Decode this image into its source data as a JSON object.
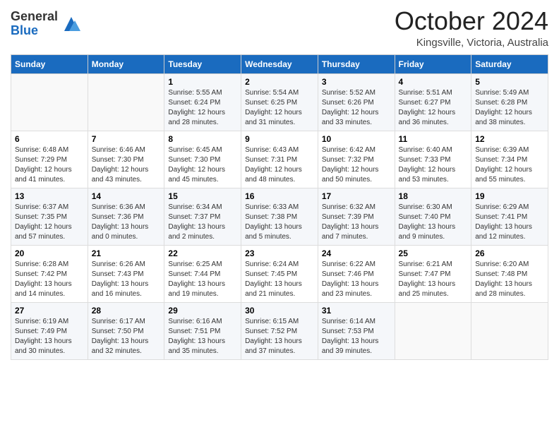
{
  "header": {
    "logo_general": "General",
    "logo_blue": "Blue",
    "month_title": "October 2024",
    "location": "Kingsville, Victoria, Australia"
  },
  "weekdays": [
    "Sunday",
    "Monday",
    "Tuesday",
    "Wednesday",
    "Thursday",
    "Friday",
    "Saturday"
  ],
  "weeks": [
    [
      {
        "day": "",
        "sunrise": "",
        "sunset": "",
        "daylight": ""
      },
      {
        "day": "",
        "sunrise": "",
        "sunset": "",
        "daylight": ""
      },
      {
        "day": "1",
        "sunrise": "Sunrise: 5:55 AM",
        "sunset": "Sunset: 6:24 PM",
        "daylight": "Daylight: 12 hours and 28 minutes."
      },
      {
        "day": "2",
        "sunrise": "Sunrise: 5:54 AM",
        "sunset": "Sunset: 6:25 PM",
        "daylight": "Daylight: 12 hours and 31 minutes."
      },
      {
        "day": "3",
        "sunrise": "Sunrise: 5:52 AM",
        "sunset": "Sunset: 6:26 PM",
        "daylight": "Daylight: 12 hours and 33 minutes."
      },
      {
        "day": "4",
        "sunrise": "Sunrise: 5:51 AM",
        "sunset": "Sunset: 6:27 PM",
        "daylight": "Daylight: 12 hours and 36 minutes."
      },
      {
        "day": "5",
        "sunrise": "Sunrise: 5:49 AM",
        "sunset": "Sunset: 6:28 PM",
        "daylight": "Daylight: 12 hours and 38 minutes."
      }
    ],
    [
      {
        "day": "6",
        "sunrise": "Sunrise: 6:48 AM",
        "sunset": "Sunset: 7:29 PM",
        "daylight": "Daylight: 12 hours and 41 minutes."
      },
      {
        "day": "7",
        "sunrise": "Sunrise: 6:46 AM",
        "sunset": "Sunset: 7:30 PM",
        "daylight": "Daylight: 12 hours and 43 minutes."
      },
      {
        "day": "8",
        "sunrise": "Sunrise: 6:45 AM",
        "sunset": "Sunset: 7:30 PM",
        "daylight": "Daylight: 12 hours and 45 minutes."
      },
      {
        "day": "9",
        "sunrise": "Sunrise: 6:43 AM",
        "sunset": "Sunset: 7:31 PM",
        "daylight": "Daylight: 12 hours and 48 minutes."
      },
      {
        "day": "10",
        "sunrise": "Sunrise: 6:42 AM",
        "sunset": "Sunset: 7:32 PM",
        "daylight": "Daylight: 12 hours and 50 minutes."
      },
      {
        "day": "11",
        "sunrise": "Sunrise: 6:40 AM",
        "sunset": "Sunset: 7:33 PM",
        "daylight": "Daylight: 12 hours and 53 minutes."
      },
      {
        "day": "12",
        "sunrise": "Sunrise: 6:39 AM",
        "sunset": "Sunset: 7:34 PM",
        "daylight": "Daylight: 12 hours and 55 minutes."
      }
    ],
    [
      {
        "day": "13",
        "sunrise": "Sunrise: 6:37 AM",
        "sunset": "Sunset: 7:35 PM",
        "daylight": "Daylight: 12 hours and 57 minutes."
      },
      {
        "day": "14",
        "sunrise": "Sunrise: 6:36 AM",
        "sunset": "Sunset: 7:36 PM",
        "daylight": "Daylight: 13 hours and 0 minutes."
      },
      {
        "day": "15",
        "sunrise": "Sunrise: 6:34 AM",
        "sunset": "Sunset: 7:37 PM",
        "daylight": "Daylight: 13 hours and 2 minutes."
      },
      {
        "day": "16",
        "sunrise": "Sunrise: 6:33 AM",
        "sunset": "Sunset: 7:38 PM",
        "daylight": "Daylight: 13 hours and 5 minutes."
      },
      {
        "day": "17",
        "sunrise": "Sunrise: 6:32 AM",
        "sunset": "Sunset: 7:39 PM",
        "daylight": "Daylight: 13 hours and 7 minutes."
      },
      {
        "day": "18",
        "sunrise": "Sunrise: 6:30 AM",
        "sunset": "Sunset: 7:40 PM",
        "daylight": "Daylight: 13 hours and 9 minutes."
      },
      {
        "day": "19",
        "sunrise": "Sunrise: 6:29 AM",
        "sunset": "Sunset: 7:41 PM",
        "daylight": "Daylight: 13 hours and 12 minutes."
      }
    ],
    [
      {
        "day": "20",
        "sunrise": "Sunrise: 6:28 AM",
        "sunset": "Sunset: 7:42 PM",
        "daylight": "Daylight: 13 hours and 14 minutes."
      },
      {
        "day": "21",
        "sunrise": "Sunrise: 6:26 AM",
        "sunset": "Sunset: 7:43 PM",
        "daylight": "Daylight: 13 hours and 16 minutes."
      },
      {
        "day": "22",
        "sunrise": "Sunrise: 6:25 AM",
        "sunset": "Sunset: 7:44 PM",
        "daylight": "Daylight: 13 hours and 19 minutes."
      },
      {
        "day": "23",
        "sunrise": "Sunrise: 6:24 AM",
        "sunset": "Sunset: 7:45 PM",
        "daylight": "Daylight: 13 hours and 21 minutes."
      },
      {
        "day": "24",
        "sunrise": "Sunrise: 6:22 AM",
        "sunset": "Sunset: 7:46 PM",
        "daylight": "Daylight: 13 hours and 23 minutes."
      },
      {
        "day": "25",
        "sunrise": "Sunrise: 6:21 AM",
        "sunset": "Sunset: 7:47 PM",
        "daylight": "Daylight: 13 hours and 25 minutes."
      },
      {
        "day": "26",
        "sunrise": "Sunrise: 6:20 AM",
        "sunset": "Sunset: 7:48 PM",
        "daylight": "Daylight: 13 hours and 28 minutes."
      }
    ],
    [
      {
        "day": "27",
        "sunrise": "Sunrise: 6:19 AM",
        "sunset": "Sunset: 7:49 PM",
        "daylight": "Daylight: 13 hours and 30 minutes."
      },
      {
        "day": "28",
        "sunrise": "Sunrise: 6:17 AM",
        "sunset": "Sunset: 7:50 PM",
        "daylight": "Daylight: 13 hours and 32 minutes."
      },
      {
        "day": "29",
        "sunrise": "Sunrise: 6:16 AM",
        "sunset": "Sunset: 7:51 PM",
        "daylight": "Daylight: 13 hours and 35 minutes."
      },
      {
        "day": "30",
        "sunrise": "Sunrise: 6:15 AM",
        "sunset": "Sunset: 7:52 PM",
        "daylight": "Daylight: 13 hours and 37 minutes."
      },
      {
        "day": "31",
        "sunrise": "Sunrise: 6:14 AM",
        "sunset": "Sunset: 7:53 PM",
        "daylight": "Daylight: 13 hours and 39 minutes."
      },
      {
        "day": "",
        "sunrise": "",
        "sunset": "",
        "daylight": ""
      },
      {
        "day": "",
        "sunrise": "",
        "sunset": "",
        "daylight": ""
      }
    ]
  ]
}
